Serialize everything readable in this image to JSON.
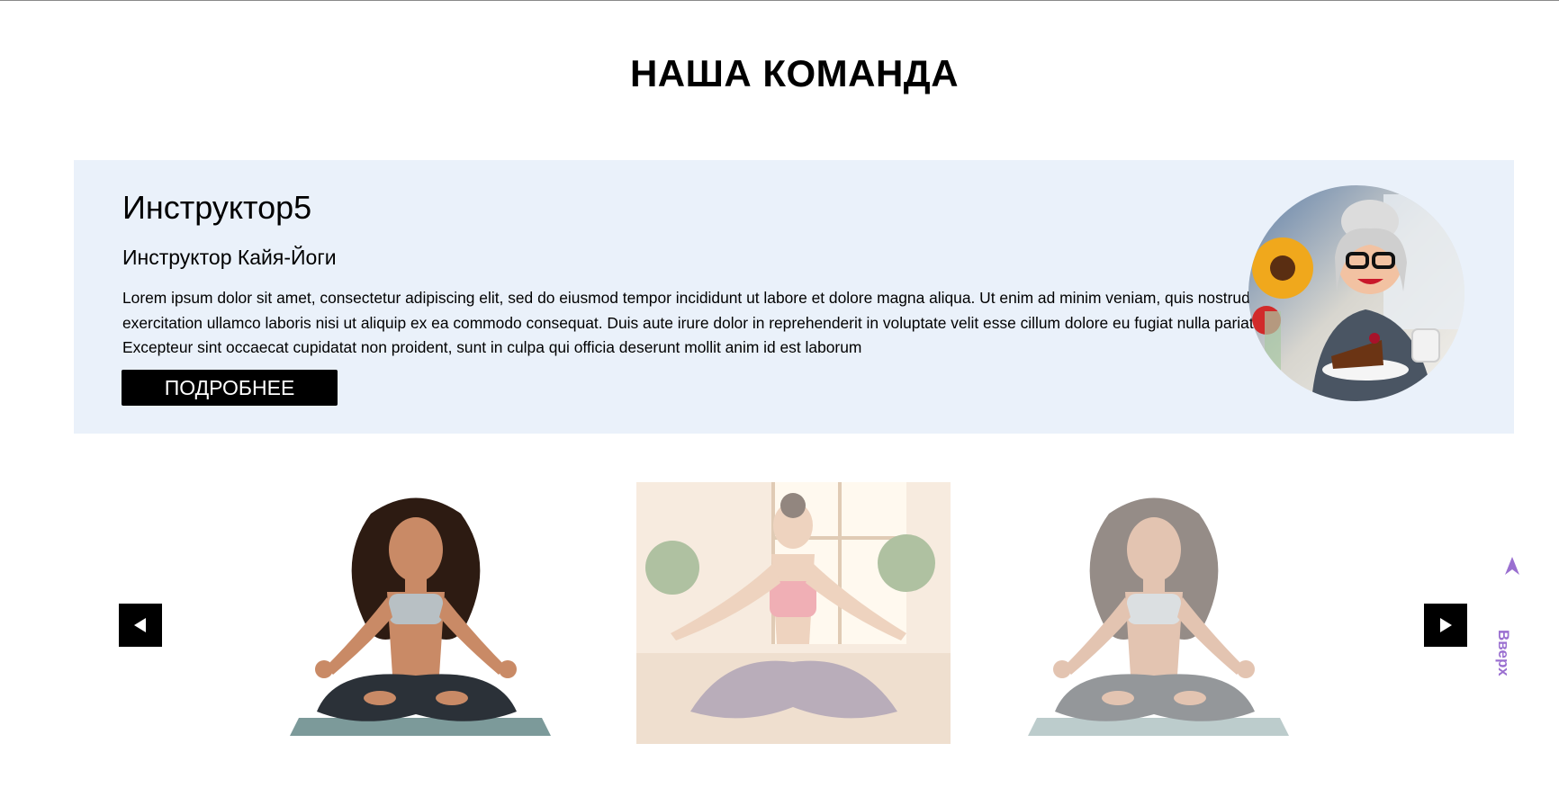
{
  "section": {
    "title": "НАША КОМАНДА"
  },
  "instructor": {
    "name": "Инструктор5",
    "role": "Инструктор Кайя-Йоги",
    "description": "Lorem ipsum dolor sit amet, consectetur adipiscing elit, sed do eiusmod tempor incididunt ut labore et dolore magna aliqua. Ut enim ad minim veniam, quis nostrud exercitation ullamco laboris nisi ut aliquip ex ea commodo consequat. Duis aute irure dolor in reprehenderit in voluptate velit esse cillum dolore eu fugiat nulla pariatur. Excepteur sint occaecat cupidatat non proident, sunt in culpa qui officia deserunt mollit anim id est laborum",
    "more_button": "ПОДРОБНЕЕ",
    "card_background": "#eaf1fa"
  },
  "carousel": {
    "prev_icon": "triangle-left-icon",
    "next_icon": "triangle-right-icon",
    "slides": [
      {
        "picture": "woman-curly-hair-meditating"
      },
      {
        "picture": "woman-bun-meditating-room"
      },
      {
        "picture": "woman-curly-hair-meditating"
      }
    ]
  },
  "back_to_top": {
    "label": "Вверх",
    "icon": "arrow-up-icon",
    "color": "#9a6fd0"
  }
}
